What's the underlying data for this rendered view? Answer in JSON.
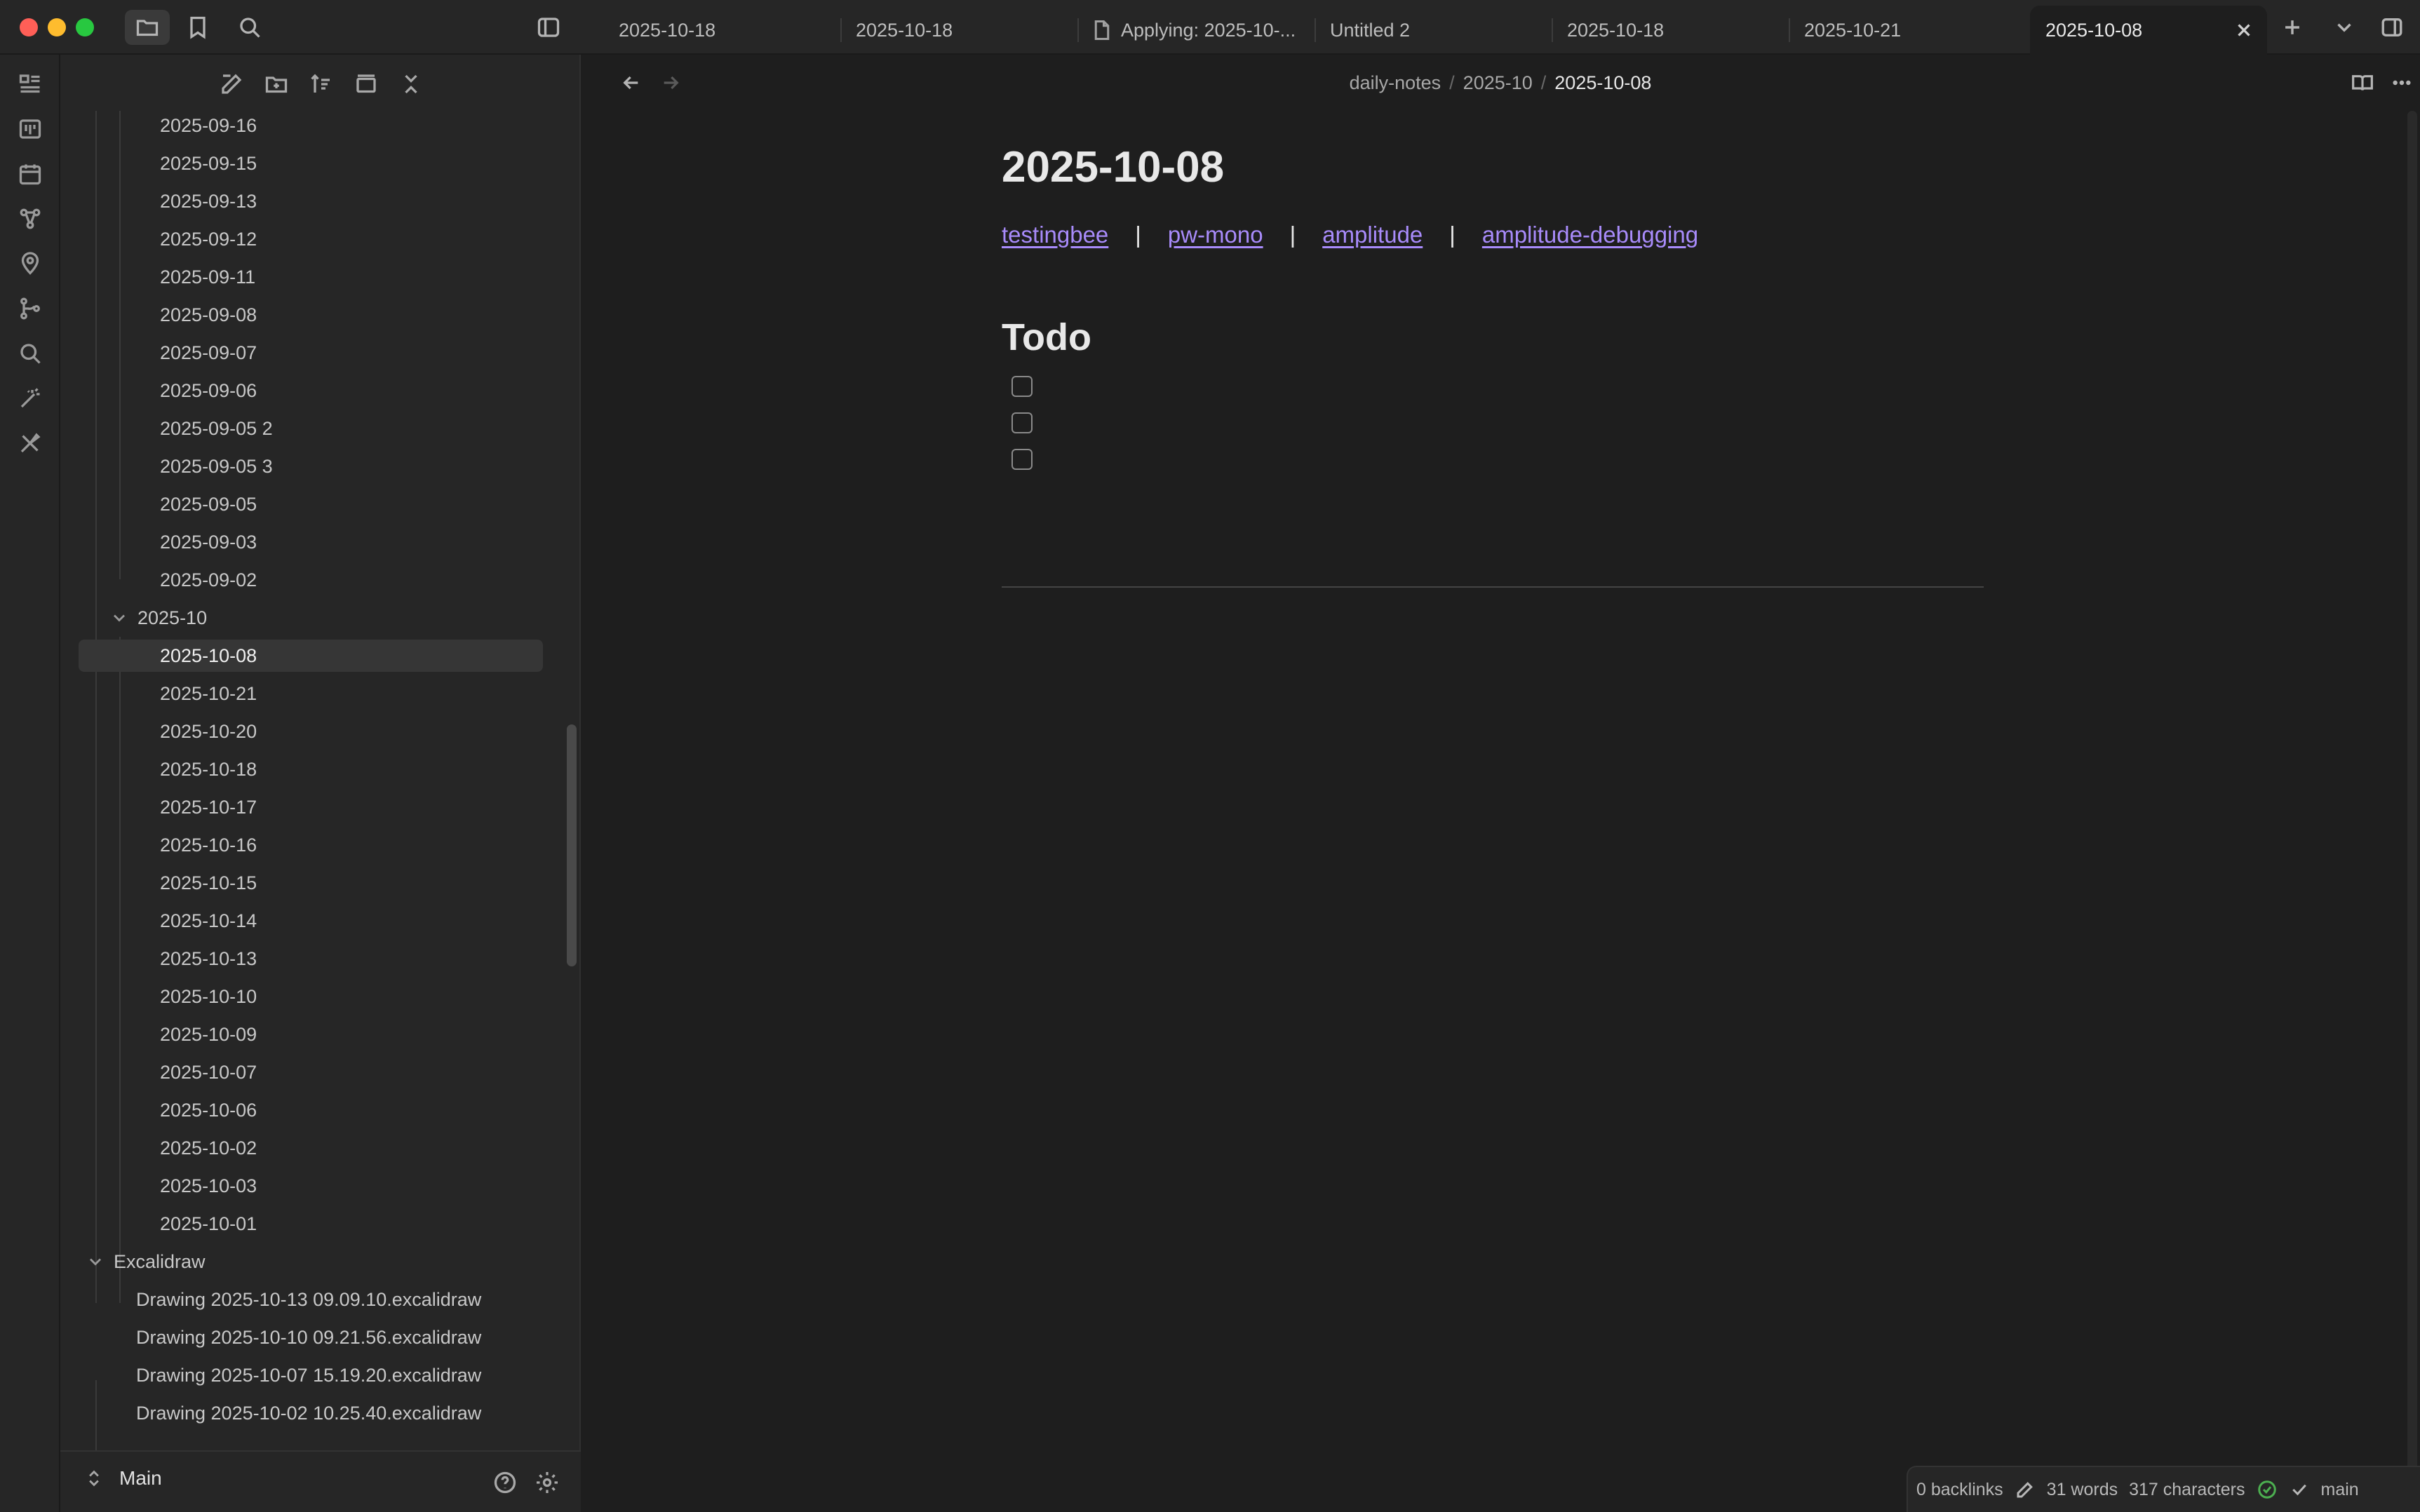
{
  "tabs": [
    {
      "label": "2025-10-18",
      "icon": "",
      "active": false
    },
    {
      "label": "2025-10-18",
      "icon": "",
      "active": false
    },
    {
      "label": "Applying: 2025-10-...",
      "icon": "file-icon",
      "active": false
    },
    {
      "label": "Untitled 2",
      "icon": "",
      "active": false
    },
    {
      "label": "2025-10-18",
      "icon": "",
      "active": false
    },
    {
      "label": "2025-10-21",
      "icon": "",
      "active": false
    },
    {
      "label": "2025-10-08",
      "icon": "",
      "active": true
    }
  ],
  "tree": {
    "september": [
      "2025-09-16",
      "2025-09-15",
      "2025-09-13",
      "2025-09-12",
      "2025-09-11",
      "2025-09-08",
      "2025-09-07",
      "2025-09-06",
      "2025-09-05 2",
      "2025-09-05 3",
      "2025-09-05",
      "2025-09-03",
      "2025-09-02"
    ],
    "october_folder": "2025-10",
    "october": [
      "2025-10-08",
      "2025-10-21",
      "2025-10-20",
      "2025-10-18",
      "2025-10-17",
      "2025-10-16",
      "2025-10-15",
      "2025-10-14",
      "2025-10-13",
      "2025-10-10",
      "2025-10-09",
      "2025-10-07",
      "2025-10-06",
      "2025-10-02",
      "2025-10-03",
      "2025-10-01"
    ],
    "active_item": "2025-10-08",
    "excalidraw_folder": "Excalidraw",
    "excalidraw": [
      "Drawing 2025-10-13 09.09.10.excalidraw",
      "Drawing 2025-10-10 09.21.56.excalidraw",
      "Drawing 2025-10-07 15.19.20.excalidraw",
      "Drawing 2025-10-02 10.25.40.excalidraw"
    ]
  },
  "vault": {
    "name": "Main"
  },
  "breadcrumb": [
    "daily-notes",
    "2025-10",
    "2025-10-08"
  ],
  "note": {
    "title": "2025-10-08",
    "links": [
      "testingbee",
      "pw-mono",
      "amplitude",
      "amplitude-debugging"
    ],
    "link_separator": "|",
    "todo_heading": "Todo",
    "todo_count": 3
  },
  "status": {
    "backlinks": "0 backlinks",
    "words": "31 words",
    "characters": "317 characters",
    "branch": "main"
  },
  "colors": {
    "accent_link": "#a88bfa",
    "sync_ok": "#4caf50",
    "background": "#1e1e1e",
    "sidebar": "#262626"
  }
}
